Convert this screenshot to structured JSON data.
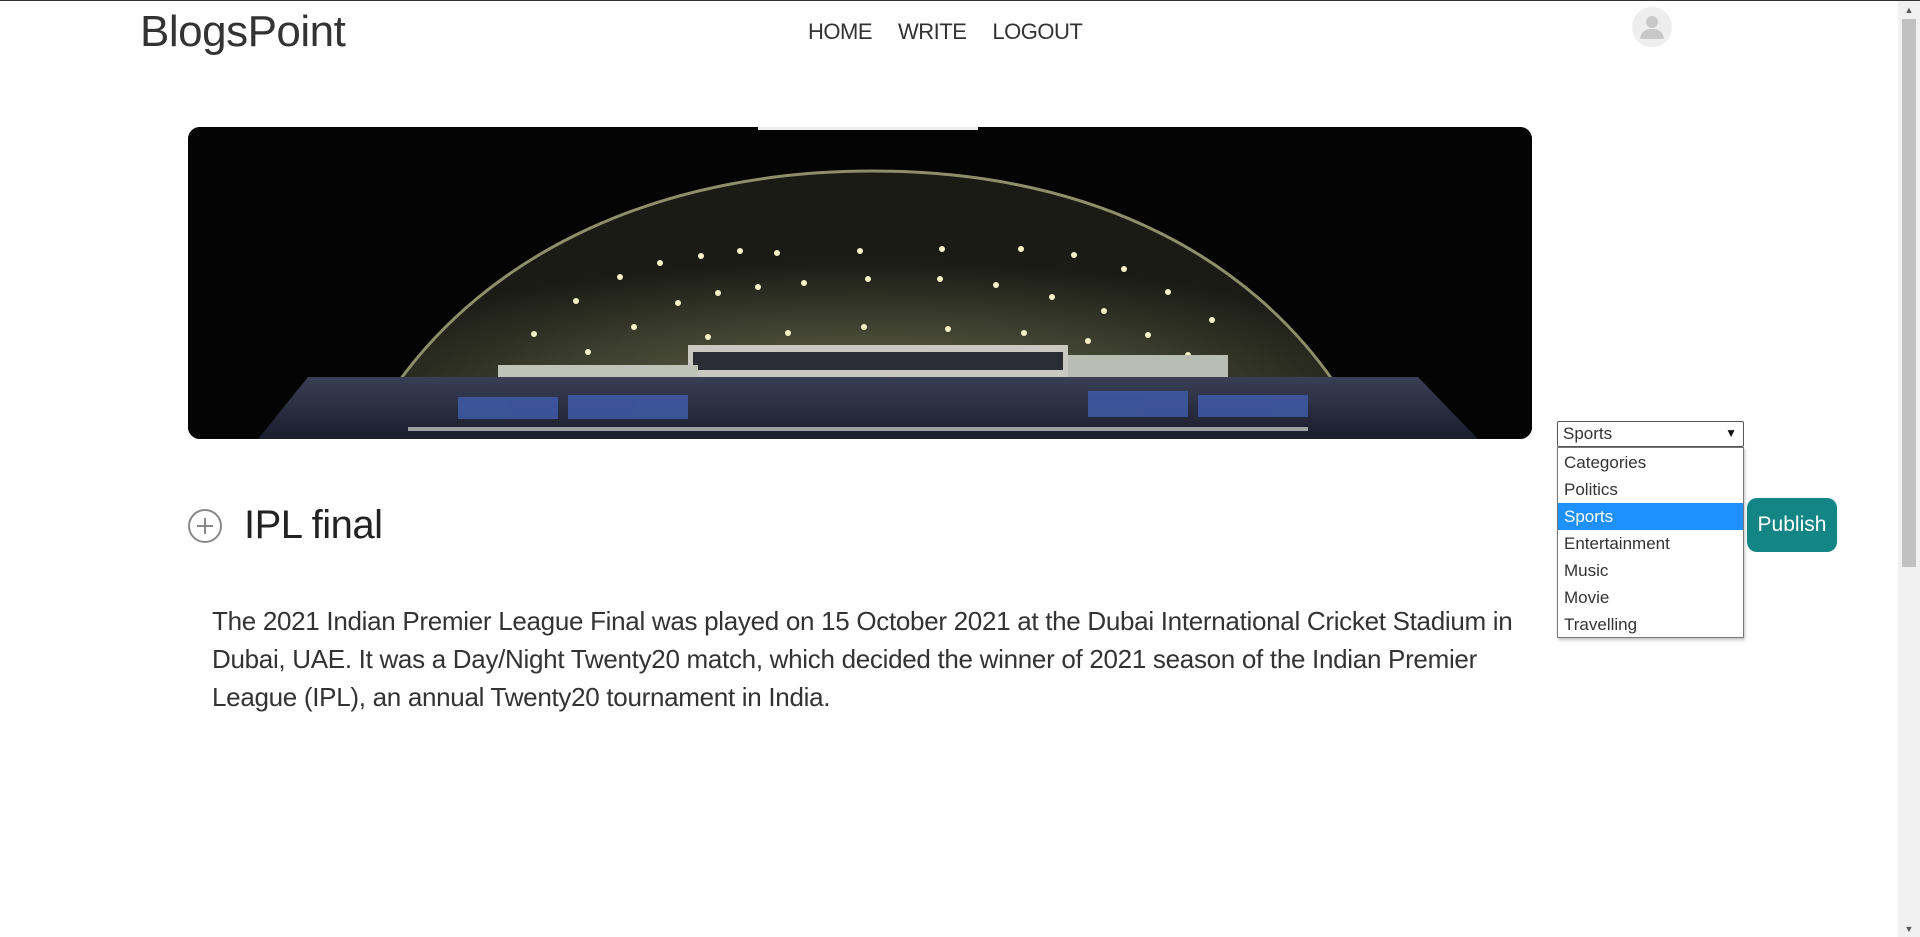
{
  "header": {
    "brand": "BlogsPoint",
    "nav": [
      {
        "label": "HOME"
      },
      {
        "label": "WRITE"
      },
      {
        "label": "LOGOUT"
      }
    ],
    "avatar_icon": "user-avatar-icon"
  },
  "post": {
    "cover_image": "cricket-stadium-night-photo",
    "add_icon": "plus-circle-icon",
    "title_value": "IPL final",
    "body": "The 2021 Indian Premier League Final was played on 15 October 2021 at the Dubai International Cricket Stadium in Dubai, UAE. It was a Day/Night Twenty20 match, which decided the winner of 2021 season of the Indian Premier League (IPL), an annual Twenty20 tournament in India."
  },
  "category": {
    "selected": "Sports",
    "options": [
      "Categories",
      "Politics",
      "Sports",
      "Entertainment",
      "Music",
      "Movie",
      "Travelling"
    ]
  },
  "publish_label": "Publish",
  "colors": {
    "publish_bg": "#138585",
    "option_highlight": "#1e90ff"
  }
}
